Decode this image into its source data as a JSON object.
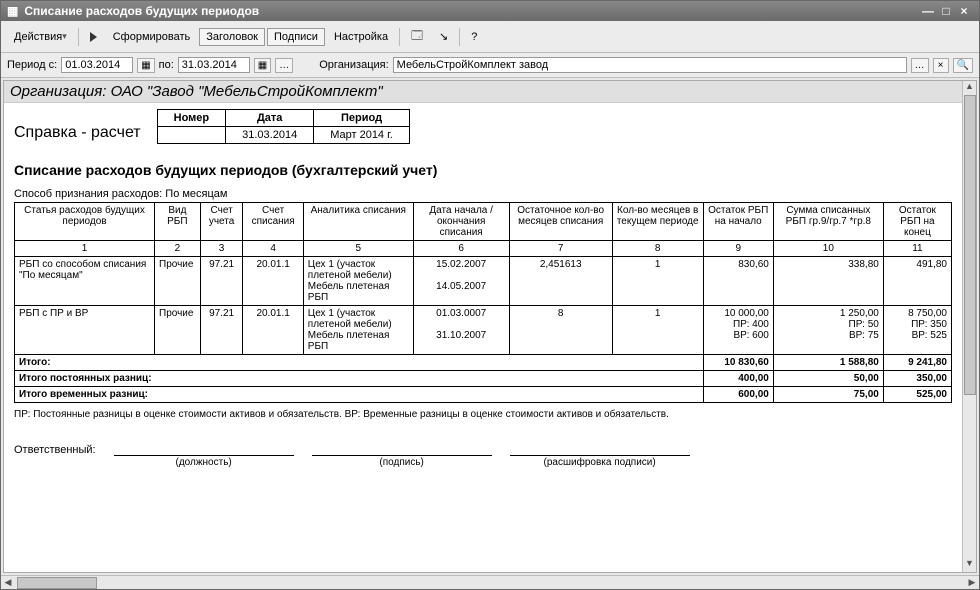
{
  "window": {
    "title": "Списание расходов будущих периодов"
  },
  "toolbar": {
    "actions": "Действия",
    "form": "Сформировать",
    "header": "Заголовок",
    "signs": "Подписи",
    "setup": "Настройка"
  },
  "filter": {
    "period_from_label": "Период с:",
    "period_from": "01.03.2014",
    "period_to_label": "по:",
    "period_to": "31.03.2014",
    "org_label": "Организация:",
    "org_value": "МебельСтройКомплект завод"
  },
  "report": {
    "org_line": "Организация: ОАО \"Завод \"МебельСтройКомплект\"",
    "doc_title": "Справка - расчет",
    "mini": {
      "h_num": "Номер",
      "h_date": "Дата",
      "h_period": "Период",
      "v_num": "",
      "v_date": "31.03.2014",
      "v_period": "Март 2014 г."
    },
    "title": "Списание расходов будущих периодов (бухгалтерский учет)",
    "method_line": "Способ признания расходов: По месяцам",
    "cols": {
      "c1": "Статья расходов будущих периодов",
      "c2": "Вид РБП",
      "c3": "Счет учета",
      "c4": "Счет списания",
      "c5": "Аналитика списания",
      "c6": "Дата начала / окончания списания",
      "c7": "Остаточное кол-во месяцев списания",
      "c8": "Кол-во месяцев в текущем периоде",
      "c9": "Остаток РБП на начало",
      "c10": "Сумма списанных РБП гр.9/гр.7 *гр.8",
      "c11": "Остаток РБП на конец"
    },
    "nums": {
      "n1": "1",
      "n2": "2",
      "n3": "3",
      "n4": "4",
      "n5": "5",
      "n6": "6",
      "n7": "7",
      "n8": "8",
      "n9": "9",
      "n10": "10",
      "n11": "11"
    },
    "rows": [
      {
        "article": "РБП со способом списания \"По месяцам\"",
        "type": "Прочие",
        "acct": "97.21",
        "acct2": "20.01.1",
        "analytic": "Цех 1 (участок плетеной мебели)\nМебель плетеная\nРБП",
        "date_start": "15.02.2007",
        "date_end": "14.05.2007",
        "remain_months": "2,451613",
        "cur_months": "1",
        "begin": "830,60",
        "writeoff": "338,80",
        "end": "491,80"
      },
      {
        "article": "РБП с ПР и ВР",
        "type": "Прочие",
        "acct": "97.21",
        "acct2": "20.01.1",
        "analytic": "Цех 1 (участок плетеной мебели)\nМебель плетеная\nРБП",
        "date_start": "01.03.0007",
        "date_end": "31.10.2007",
        "remain_months": "8",
        "cur_months": "1",
        "begin": "10 000,00",
        "begin_pr": "ПР: 400",
        "begin_vr": "ВР: 600",
        "writeoff": "1 250,00",
        "writeoff_pr": "ПР: 50",
        "writeoff_vr": "ВР: 75",
        "end": "8 750,00",
        "end_pr": "ПР: 350",
        "end_vr": "ВР: 525"
      }
    ],
    "totals": {
      "t1_label": "Итого:",
      "t1_begin": "10 830,60",
      "t1_write": "1 588,80",
      "t1_end": "9 241,80",
      "t2_label": "Итого постоянных разниц:",
      "t2_begin": "400,00",
      "t2_write": "50,00",
      "t2_end": "350,00",
      "t3_label": "Итого временных разниц:",
      "t3_begin": "600,00",
      "t3_write": "75,00",
      "t3_end": "525,00"
    },
    "footnote": "ПР: Постоянные разницы в оценке стоимости активов и обязательств. ВР: Временные разницы в оценке стоимости активов и обязательств.",
    "responsible_label": "Ответственный:",
    "sign1": "(должность)",
    "sign2": "(подпись)",
    "sign3": "(расшифровка подписи)"
  }
}
